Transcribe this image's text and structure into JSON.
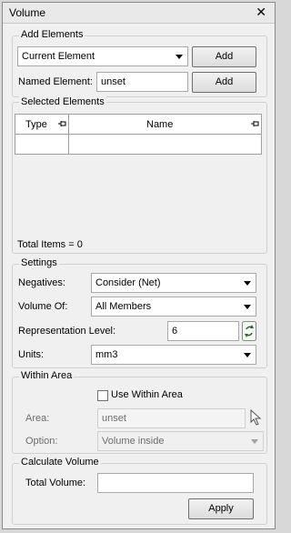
{
  "window": {
    "title": "Volume",
    "close_glyph": "✕"
  },
  "add_elements": {
    "legend": "Add Elements",
    "element_select": "Current Element",
    "add_label": "Add",
    "named_label": "Named Element:",
    "named_value": "unset",
    "add_named_label": "Add"
  },
  "selected": {
    "legend": "Selected Elements",
    "columns": [
      "Type",
      "Name"
    ],
    "total": "Total Items = 0"
  },
  "settings": {
    "legend": "Settings",
    "negatives_label": "Negatives:",
    "negatives_value": "Consider (Net)",
    "volume_of_label": "Volume Of:",
    "volume_of_value": "All Members",
    "rep_level_label": "Representation Level:",
    "rep_level_value": "6",
    "units_label": "Units:",
    "units_value": "mm3"
  },
  "within_area": {
    "legend": "Within Area",
    "use_label": "Use Within Area",
    "area_label": "Area:",
    "area_value": "unset",
    "option_label": "Option:",
    "option_value": "Volume inside"
  },
  "calculate": {
    "legend": "Calculate Volume",
    "total_label": "Total Volume:",
    "total_value": "",
    "apply_label": "Apply"
  }
}
